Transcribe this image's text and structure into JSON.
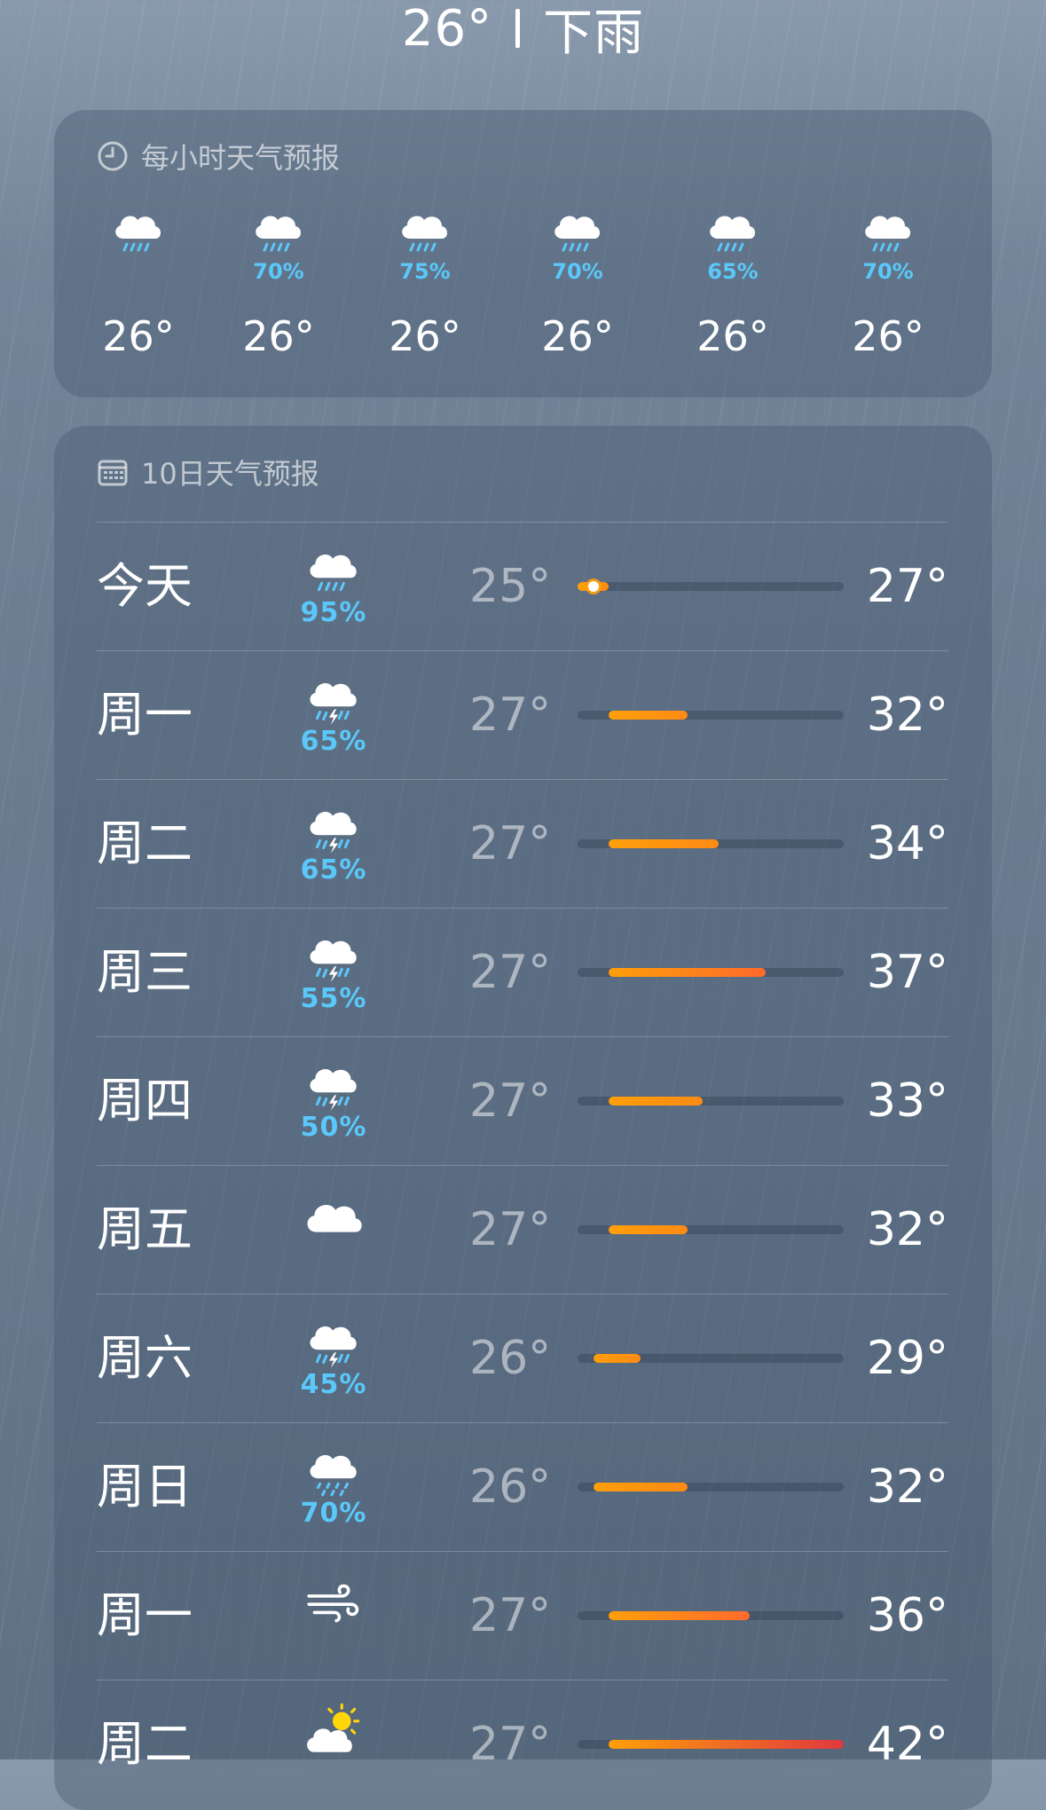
{
  "header": {
    "temp": "26°",
    "condition": "下雨"
  },
  "hourly": {
    "title": "每小时天气预报",
    "items": [
      {
        "precip": "",
        "temp": "26°",
        "icon": "rain-cloud-icon"
      },
      {
        "precip": "70%",
        "temp": "26°",
        "icon": "rain-cloud-icon"
      },
      {
        "precip": "75%",
        "temp": "26°",
        "icon": "rain-cloud-icon"
      },
      {
        "precip": "70%",
        "temp": "26°",
        "icon": "rain-cloud-icon"
      },
      {
        "precip": "65%",
        "temp": "26°",
        "icon": "rain-cloud-icon"
      },
      {
        "precip": "70%",
        "temp": "26°",
        "icon": "rain-cloud-icon"
      }
    ]
  },
  "daily": {
    "title": "10日天气预报",
    "range": {
      "min": 25,
      "max": 42
    },
    "current_temp": 26,
    "days": [
      {
        "day": "今天",
        "icon": "rain-cloud-icon",
        "precip": "95%",
        "low": "25°",
        "high": "27°",
        "low_v": 25,
        "high_v": 27
      },
      {
        "day": "周一",
        "icon": "thunderstorm-icon",
        "precip": "65%",
        "low": "27°",
        "high": "32°",
        "low_v": 27,
        "high_v": 32
      },
      {
        "day": "周二",
        "icon": "thunderstorm-icon",
        "precip": "65%",
        "low": "27°",
        "high": "34°",
        "low_v": 27,
        "high_v": 34
      },
      {
        "day": "周三",
        "icon": "thunderstorm-icon",
        "precip": "55%",
        "low": "27°",
        "high": "37°",
        "low_v": 27,
        "high_v": 37
      },
      {
        "day": "周四",
        "icon": "thunderstorm-icon",
        "precip": "50%",
        "low": "27°",
        "high": "33°",
        "low_v": 27,
        "high_v": 33
      },
      {
        "day": "周五",
        "icon": "cloud-icon",
        "precip": "",
        "low": "27°",
        "high": "32°",
        "low_v": 27,
        "high_v": 32
      },
      {
        "day": "周六",
        "icon": "thunderstorm-icon",
        "precip": "45%",
        "low": "26°",
        "high": "29°",
        "low_v": 26,
        "high_v": 29
      },
      {
        "day": "周日",
        "icon": "drizzle-cloud-icon",
        "precip": "70%",
        "low": "26°",
        "high": "32°",
        "low_v": 26,
        "high_v": 32
      },
      {
        "day": "周一",
        "icon": "wind-icon",
        "precip": "",
        "low": "27°",
        "high": "36°",
        "low_v": 27,
        "high_v": 36
      },
      {
        "day": "周二",
        "icon": "partly-sunny-icon",
        "precip": "",
        "low": "27°",
        "high": "42°",
        "low_v": 27,
        "high_v": 42
      }
    ]
  },
  "colors": {
    "precip": "#5ac8fa",
    "bar_warm": "#ff9f0a",
    "bar_hot": "#e0383e"
  }
}
